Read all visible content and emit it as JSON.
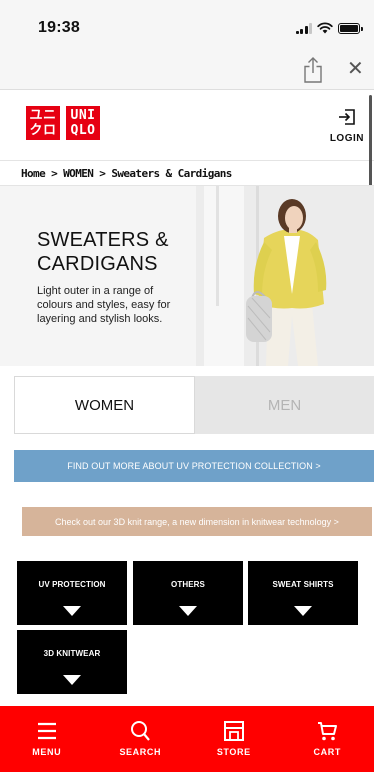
{
  "status_bar": {
    "time": "19:38"
  },
  "browser": {
    "share_icon": "share-icon",
    "close_label": "✕"
  },
  "header": {
    "logo_top": "ユニ",
    "logo_bottom": "クロ",
    "logo_en_top": "UNI",
    "logo_en_bottom": "QLO",
    "login_label": "LOGIN"
  },
  "breadcrumb": "Home > WOMEN > Sweaters & Cardigans",
  "hero": {
    "title_line1": "SWEATERS &",
    "title_line2": "CARDIGANS",
    "description": "Light outer in a range of colours and styles, easy for layering and stylish looks."
  },
  "tabs": [
    {
      "label": "WOMEN",
      "active": true
    },
    {
      "label": "MEN",
      "active": false
    }
  ],
  "banners": {
    "uv": "FIND OUT MORE ABOUT UV PROTECTION COLLECTION >",
    "knit": "Check out our 3D knit range, a new dimension in knitwear technology >"
  },
  "categories": [
    {
      "label": "UV PROTECTION"
    },
    {
      "label": "OTHERS"
    },
    {
      "label": "SWEAT SHIRTS"
    },
    {
      "label": "3D KNITWEAR"
    }
  ],
  "bottom_nav": [
    {
      "label": "MENU",
      "icon": "menu-icon"
    },
    {
      "label": "SEARCH",
      "icon": "search-icon"
    },
    {
      "label": "STORE",
      "icon": "store-icon"
    },
    {
      "label": "CART",
      "icon": "cart-icon"
    }
  ],
  "colors": {
    "brand_red": "#e60012",
    "nav_red": "#ff0000",
    "uv_banner": "#6fa1c9",
    "knit_banner": "#d6b49a",
    "cardigan_yellow": "#e8d95a"
  }
}
